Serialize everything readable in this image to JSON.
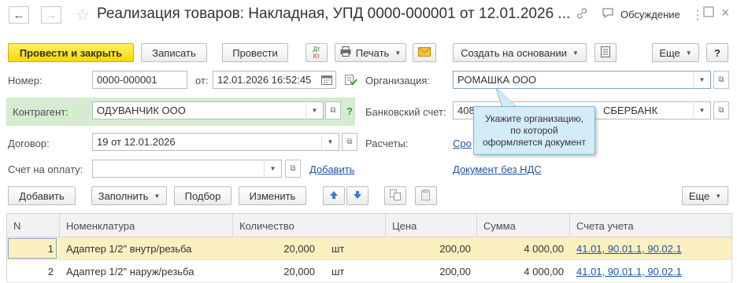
{
  "window": {
    "title": "Реализация товаров: Накладная, УПД 0000-000001 от 12.01.2026 ...",
    "discuss_label": "Обсуждение",
    "nav_back_icon": "arrow-left-icon",
    "nav_forward_icon": "arrow-right-icon"
  },
  "toolbar": {
    "post_close_label": "Провести и закрыть",
    "save_label": "Записать",
    "post_label": "Провести",
    "dt_kt_top": "Дт",
    "dt_kt_bottom": "Кт",
    "print_label": "Печать",
    "create_based_label": "Создать на основании",
    "more_label": "Еще",
    "help_label": "?"
  },
  "form": {
    "number_label": "Номер:",
    "number_value": "0000-000001",
    "date_label": "от:",
    "date_value": "12.01.2026 16:52:45",
    "organization_label": "Организация:",
    "organization_value": "РОМАШКА ООО",
    "counterparty_label": "Контрагент:",
    "counterparty_value": "ОДУВАНЧИК ООО",
    "bank_account_label": "Банковский счет:",
    "bank_account_value_left": "408",
    "bank_account_value_right": "СБЕРБАНК",
    "contract_label": "Договор:",
    "contract_value": "19 от 12.01.2026",
    "settlements_label": "Расчеты:",
    "settlements_link": "Сро",
    "invoice_label": "Счет на оплату:",
    "invoice_value": "",
    "invoice_add_link": "Добавить",
    "vat_link": "Документ без НДС",
    "help_mark": "?"
  },
  "tooltip": {
    "line1": "Укажите организацию,",
    "line2": "по которой",
    "line3": "оформляется документ"
  },
  "table_toolbar": {
    "add_label": "Добавить",
    "fill_label": "Заполнить",
    "pick_label": "Подбор",
    "change_label": "Изменить",
    "more_label": "Еще"
  },
  "table": {
    "columns": [
      "N",
      "Номенклатура",
      "Количество",
      "Цена",
      "Сумма",
      "Счета учета"
    ],
    "rows": [
      {
        "n": "1",
        "item": "Адаптер 1/2\" внутр/резьба",
        "qty": "20,000",
        "unit": "шт",
        "price": "200,00",
        "sum": "4 000,00",
        "accounts": "41.01, 90.01.1, 90.02.1"
      },
      {
        "n": "2",
        "item": "Адаптер 1/2\" наруж/резьба",
        "qty": "20,000",
        "unit": "шт",
        "price": "200,00",
        "sum": "4 000,00",
        "accounts": "41.01, 90.01.1, 90.02.1"
      }
    ]
  },
  "colors": {
    "primary_button": "#f7d800",
    "counterparty_highlight": "#d6ecd1",
    "tooltip_bg": "#d4ebf8",
    "selected_row": "#fbf0c0",
    "link": "#1d55a6"
  }
}
